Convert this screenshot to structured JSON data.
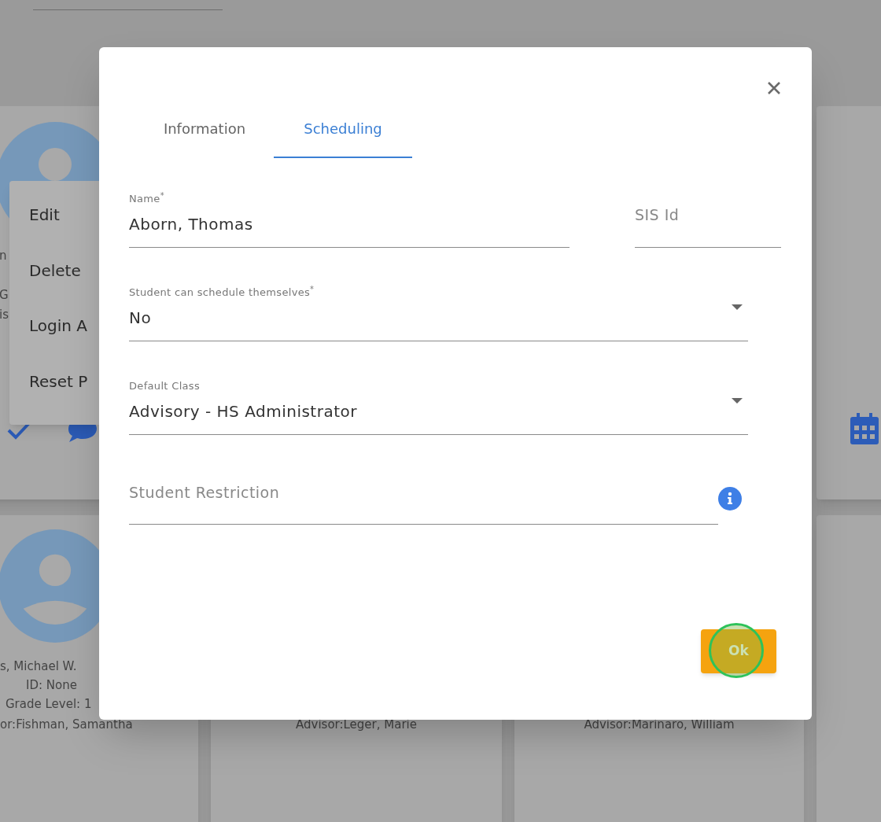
{
  "top_row_card": {
    "lines": [
      "n",
      "G",
      "is"
    ]
  },
  "bottom_row_cards": [
    {
      "name": "s, Michael W.",
      "id": "ID: None",
      "grade": "Grade Level: 1",
      "advisor": "or:Fishman, Samantha"
    },
    {
      "advisor": "Advisor:Leger, Marie"
    },
    {
      "advisor": "Advisor:Marinaro, William"
    }
  ],
  "context_menu": {
    "items": [
      "Edit",
      "Delete",
      "Login A",
      "Reset P"
    ]
  },
  "dialog": {
    "tabs": [
      {
        "label": "Information",
        "selected": false
      },
      {
        "label": "Scheduling",
        "selected": true
      }
    ],
    "fields": [
      {
        "kind": "text",
        "label": "Name$^{*}$",
        "value": "Aborn, Thomas"
      },
      {
        "kind": "text",
        "placeholder": "SIS Id"
      },
      {
        "kind": "select",
        "label": "Student can schedule themselves$^{*}$",
        "value": "No"
      },
      {
        "kind": "select",
        "label": "Default Class",
        "value": "Advisory - HS Administrator"
      },
      {
        "kind": "info",
        "placeholder": "Student Restriction"
      }
    ],
    "ok_button": "Ok"
  }
}
